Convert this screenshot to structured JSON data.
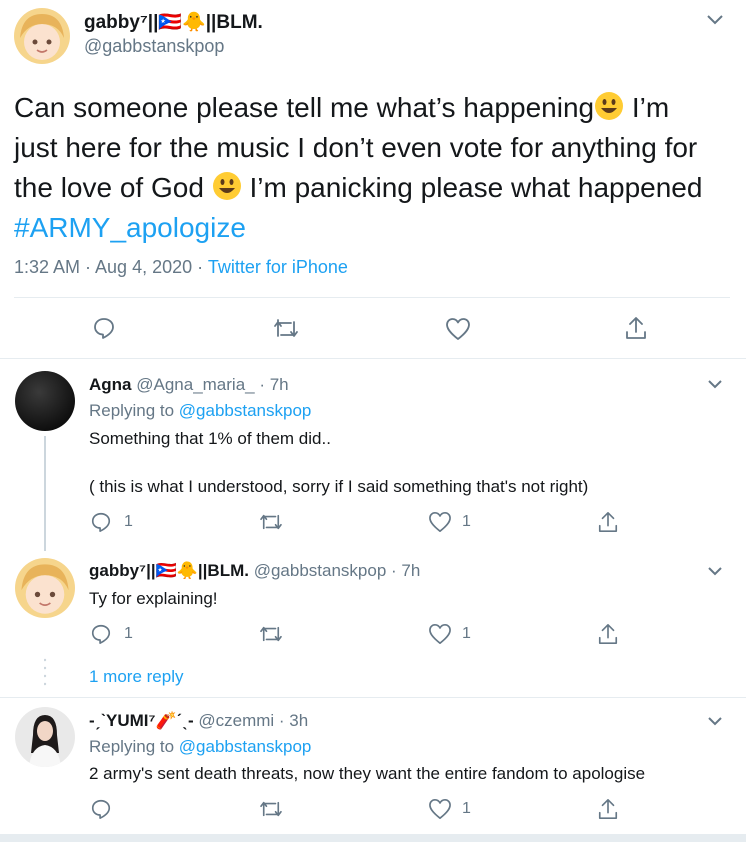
{
  "main_tweet": {
    "display_name": "gabby⁷||🇵🇷🐥||BLM.",
    "handle": "@gabbstanskpop",
    "text_part1": "Can someone please tell me what’s happening",
    "text_part2": " I’m just here for the music I don’t even vote for anything for the love of God ",
    "text_part3": " I’m panicking please what happened ",
    "hashtag": "#ARMY_apologize",
    "timestamp": "1:32 AM · Aug 4, 2020 · ",
    "source": "Twitter for iPhone"
  },
  "replies": [
    {
      "display_name": "Agna",
      "handle": "@Agna_maria_",
      "age": " · 7h",
      "replying_prefix": "Replying to ",
      "replying_to": "@gabbstanskpop",
      "text_line1": "Something that 1% of them did..",
      "text_line2": "( this is what I understood, sorry if I said something that's not right)",
      "reply_count": "1",
      "retweet_count": "",
      "like_count": "1"
    },
    {
      "display_name": "gabby⁷||🇵🇷🐥||BLM.",
      "handle": "@gabbstanskpop",
      "age": " · 7h",
      "text_line1": "Ty for explaining!",
      "reply_count": "1",
      "retweet_count": "",
      "like_count": "1"
    },
    {
      "display_name": "-ˏˋYUMI⁷🧨ˊˎ-",
      "handle": "@czemmi",
      "age": " · 3h",
      "replying_prefix": "Replying to ",
      "replying_to": "@gabbstanskpop",
      "text_line1": "2 army's sent death threats, now they want the entire fandom to apologise",
      "reply_count": "",
      "retweet_count": "",
      "like_count": "1"
    }
  ],
  "more_replies_label": "1 more reply",
  "colors": {
    "accent": "#1da1f2",
    "muted": "#657786",
    "divider": "#e6ecf0"
  },
  "icons": [
    "chevron-down-icon",
    "reply-icon",
    "retweet-icon",
    "like-icon",
    "share-icon"
  ]
}
